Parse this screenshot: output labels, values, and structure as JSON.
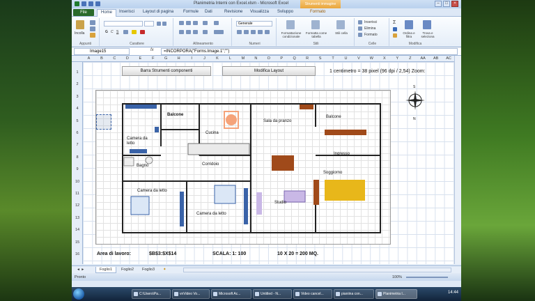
{
  "window": {
    "title": "Planimetria Interni con Excel.xlsm - Microsoft Excel",
    "context_tab": "Strumenti immagine"
  },
  "tabs": [
    "File",
    "Home",
    "Inserisci",
    "Layout di pagina",
    "Formule",
    "Dati",
    "Revisione",
    "Visualizza",
    "Sviluppo",
    "Formato"
  ],
  "ribbon": {
    "groups": [
      "Appunti",
      "Carattere",
      "Allineamento",
      "Numeri",
      "Stili",
      "Celle",
      "Modifica"
    ],
    "paste": "Incolla",
    "number_format": "Generale",
    "styles": [
      "Formattazione condizionale",
      "Formatta come tabella",
      "Stili cella"
    ],
    "cells": [
      "Inserisci",
      "Elimina",
      "Formato"
    ],
    "edit": [
      "Ordina e filtra",
      "Trova e seleziona"
    ]
  },
  "formula_bar": {
    "name_box": "Image15",
    "fx": "fx",
    "formula": "=INCORPORA(\"Forms.Image.1\";\"\")"
  },
  "columns": [
    "A",
    "B",
    "C",
    "D",
    "E",
    "F",
    "G",
    "H",
    "I",
    "J",
    "K",
    "L",
    "M",
    "N",
    "O",
    "P",
    "Q",
    "R",
    "S",
    "T",
    "U",
    "V",
    "W",
    "X",
    "Y",
    "Z",
    "AA",
    "AB",
    "AC"
  ],
  "rows": [
    "1",
    "2",
    "3",
    "4",
    "5",
    "6",
    "7",
    "8",
    "9",
    "10",
    "11",
    "12",
    "13",
    "14",
    "15",
    "16"
  ],
  "sheet": {
    "button_components": "Barra Strumenti componenti",
    "button_layout": "Modifica Layout",
    "scale_text": "1 centimetro = 38 pixel  (96 dpi / 2,54)  Zoom:",
    "rooms": {
      "balcone1": "Balcone",
      "cucina": "Cucina",
      "sala": "Sala da pranzo",
      "balcone2": "Balcone",
      "camera1": "Camera da letto",
      "bagno": "Bagno",
      "corridoio": "Corridoio",
      "ingresso": "Ingresso",
      "soggiorno": "Soggiorno",
      "camera2": "Camera da letto",
      "camera3": "Camera da letto",
      "studio": "Studio"
    },
    "compass": {
      "n": "N",
      "s": "S"
    },
    "footer": {
      "area": "Area di lavoro:",
      "range": "$B$3:$X$14",
      "scala": "SCALA:  1: 100",
      "size": "10 X 20 = 200 MQ."
    }
  },
  "sheet_tabs": [
    "Foglio1",
    "Foglio2",
    "Foglio3"
  ],
  "status": {
    "mode": "Pronto",
    "zoom": "100%"
  },
  "taskbar": {
    "items": [
      "C:\\Users\\Pa...",
      "vnVideo Vo...",
      "Microsoft Ac...",
      "Untitled - N...",
      "Video cancel...",
      "pianiina con...",
      "Planimetria I..."
    ],
    "clock": "14:44"
  },
  "colors": {
    "wall": "#222222",
    "bed": "#3a63a8",
    "wood": "#a04a1a",
    "sofa": "#e8b71a",
    "excel_green": "#2a6a2a"
  }
}
